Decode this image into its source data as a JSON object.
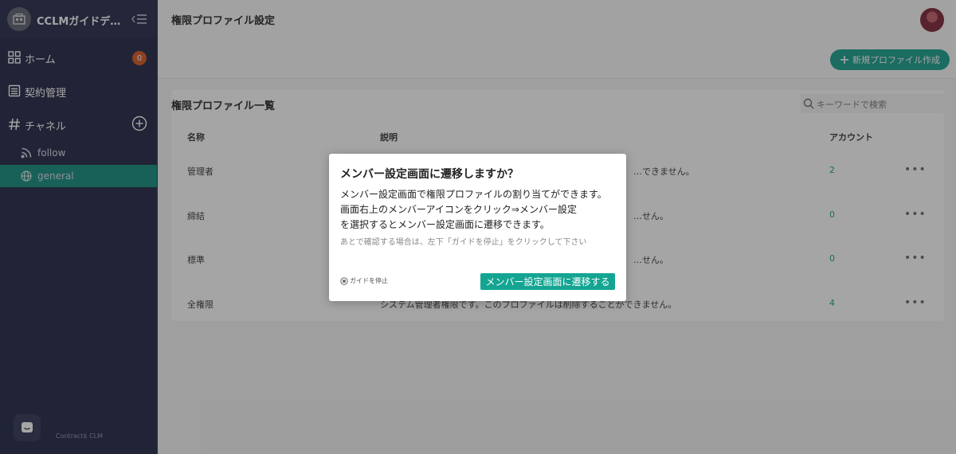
{
  "sidebar": {
    "workspace_name": "CCLMガイドデ…",
    "nav": [
      {
        "label": "ホーム",
        "icon": "grid-icon",
        "badge": "0"
      },
      {
        "label": "契約管理",
        "icon": "contract-list-icon"
      },
      {
        "label": "チャネル",
        "icon": "hash-icon"
      }
    ],
    "channels": [
      {
        "label": "follow",
        "icon": "rss-icon",
        "active": false
      },
      {
        "label": "general",
        "icon": "globe-icon",
        "active": true
      }
    ],
    "footer": "Contract$ CLM"
  },
  "header": {
    "title": "権限プロファイル設定",
    "new_button": "新規プロファイル作成"
  },
  "list": {
    "title": "権限プロファイル一覧",
    "search_placeholder": "キーワードで検索",
    "columns": {
      "name": "名称",
      "description": "説明",
      "accounts": "アカウント"
    },
    "rows": [
      {
        "name": "管理者",
        "description": "…できません。",
        "accounts": "2"
      },
      {
        "name": "締結",
        "description": "…せん。",
        "accounts": "0"
      },
      {
        "name": "標準",
        "description": "…せん。",
        "accounts": "0"
      },
      {
        "name": "全権限",
        "description": "システム管理者権限です。このプロファイルは削除することができません。",
        "accounts": "4"
      }
    ]
  },
  "modal": {
    "title": "メンバー設定画面に遷移しますか？",
    "body_lines": [
      "メンバー設定画面で権限プロファイルの割り当てができます。",
      "画面右上のメンバーアイコンをクリック⇒メンバー設定",
      "を選択するとメンバー設定画面に遷移できます。"
    ],
    "note": "あとで確認する場合は、左下「ガイドを停止」をクリックして下さい",
    "stop_guide": "ガイドを停止",
    "confirm_button": "メンバー設定画面に遷移する"
  },
  "colors": {
    "accent": "#129e8b",
    "sidebar": "#1b2240",
    "badge": "#d2541e"
  }
}
